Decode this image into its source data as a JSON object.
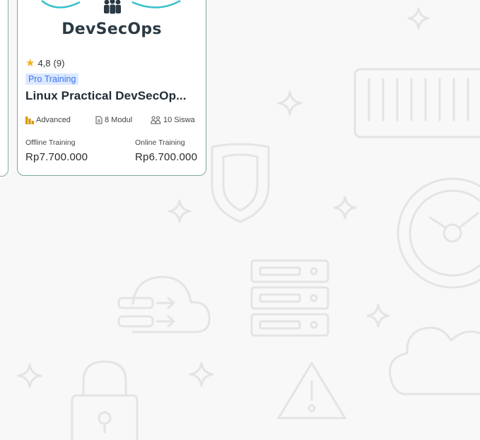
{
  "course_card": {
    "brand": "DevSecOps",
    "rating_value": "4,8",
    "rating_count": "(9)",
    "badge": "Pro Training",
    "title": "Linux Practical DevSecOp...",
    "level": "Advanced",
    "modules": "8 Modul",
    "students": "10 Siswa",
    "offline_label": "Offline Training",
    "offline_price": "Rp7.700.000",
    "online_label": "Online Training",
    "online_price": "Rp6.700.000"
  },
  "icons": {
    "rating": "star-icon",
    "level": "level-bars-icon",
    "modules": "document-icon",
    "students": "users-icon"
  },
  "colors": {
    "card_border": "#7fa99b",
    "badge_bg": "#dbe8ff",
    "badge_text": "#3d73e8",
    "star": "#f2b01e",
    "level_icon": "#d79a12",
    "hero_ring": "#37c1c9",
    "background": "#f8f8f8",
    "illustration_stroke": "#e5e5e5"
  }
}
